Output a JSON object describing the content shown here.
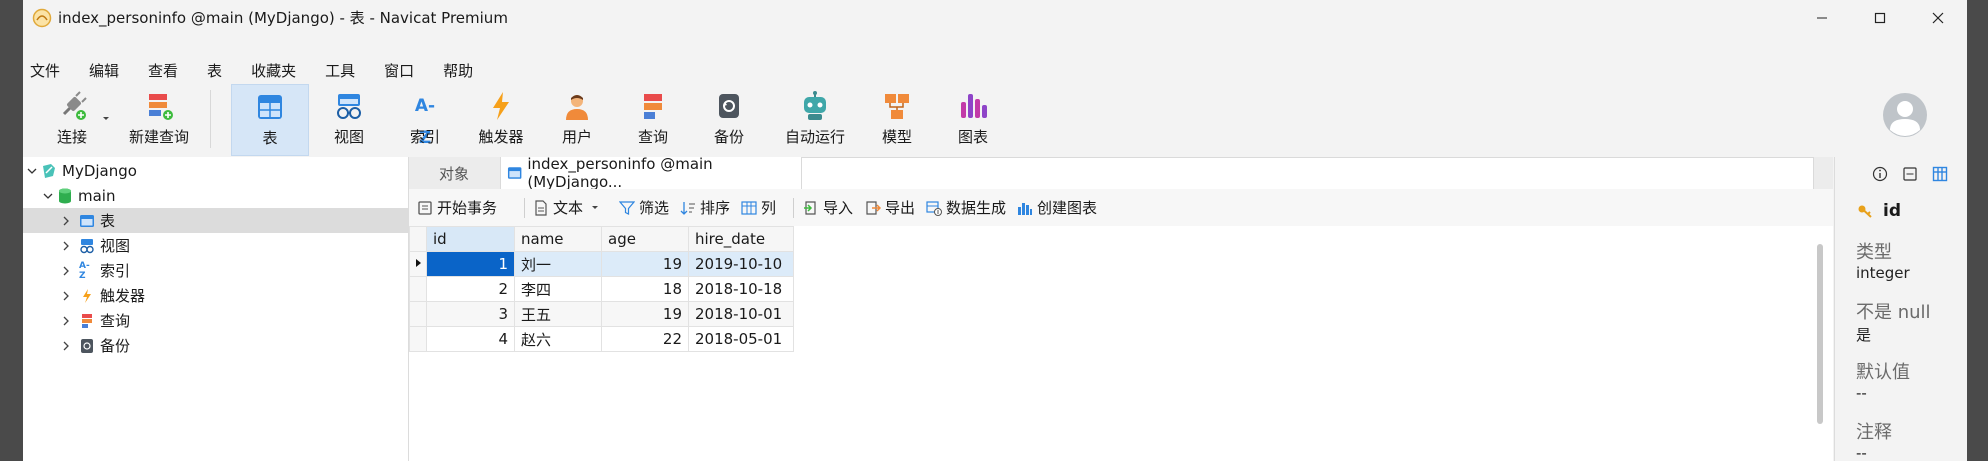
{
  "window": {
    "title": "index_personinfo @main (MyDjango) - 表 - Navicat Premium"
  },
  "menu": [
    "文件",
    "编辑",
    "查看",
    "表",
    "收藏夹",
    "工具",
    "窗口",
    "帮助"
  ],
  "toolbar": {
    "connect": "连接",
    "new_query": "新建查询",
    "table": "表",
    "view": "视图",
    "index": "索引",
    "trigger": "触发器",
    "user": "用户",
    "query": "查询",
    "backup": "备份",
    "auto_run": "自动运行",
    "model": "模型",
    "chart": "图表",
    "index_icon_text": "A-Z"
  },
  "tree": {
    "connection": "MyDjango",
    "database": "main",
    "items": [
      "表",
      "视图",
      "索引",
      "触发器",
      "查询",
      "备份"
    ],
    "selected": "表"
  },
  "tabs": {
    "objects": "对象",
    "active": "index_personinfo @main (MyDjango..."
  },
  "subtoolbar": {
    "begin_tx": "开始事务",
    "text": "文本",
    "filter": "筛选",
    "sort": "排序",
    "columns": "列",
    "import": "导入",
    "export": "导出",
    "data_gen": "数据生成",
    "create_chart": "创建图表"
  },
  "grid": {
    "columns": [
      "id",
      "name",
      "age",
      "hire_date"
    ],
    "rows": [
      [
        "1",
        "刘一",
        "19",
        "2019-10-10"
      ],
      [
        "2",
        "李四",
        "18",
        "2018-10-18"
      ],
      [
        "3",
        "王五",
        "19",
        "2018-10-01"
      ],
      [
        "4",
        "赵六",
        "22",
        "2018-05-01"
      ]
    ]
  },
  "inspector": {
    "field_name": "id",
    "type_label": "类型",
    "type_value": "integer",
    "not_null_label": "不是 null",
    "not_null_value": "是",
    "default_label": "默认值",
    "default_value": "--",
    "comment_label": "注释",
    "comment_value": "--"
  }
}
